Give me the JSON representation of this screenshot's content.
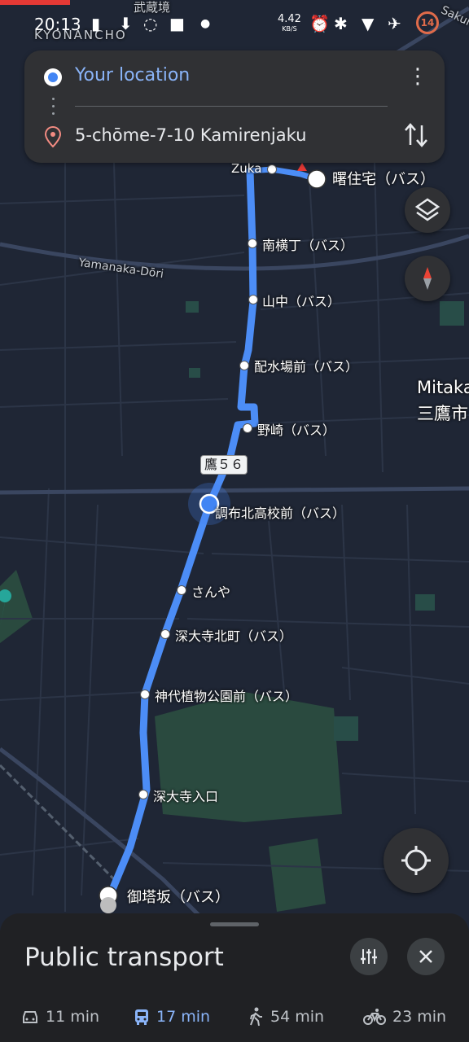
{
  "status_bar": {
    "time": "20:13",
    "speed_value": "4.42",
    "speed_unit": "KB/S",
    "battery": "14"
  },
  "search": {
    "origin": "Your location",
    "destination": "5-chōme-7-10 Kamirenjaku"
  },
  "map": {
    "area_labels": [
      "KYONANCHO",
      "武蔵境",
      "Sakura",
      "Yamanaka-Dōri",
      "Mitaka",
      "三鷹市"
    ],
    "route_badge": "鷹５６",
    "stops": [
      {
        "name": "Zuka"
      },
      {
        "name": "曙住宅（バス）"
      },
      {
        "name": "南横丁（バス）"
      },
      {
        "name": "山中（バス）"
      },
      {
        "name": "配水場前（バス）"
      },
      {
        "name": "野崎（バス）"
      },
      {
        "name": "調布北高校前（バス）"
      },
      {
        "name": "さんや"
      },
      {
        "name": "深大寺北町（バス）"
      },
      {
        "name": "神代植物公園前（バス）"
      },
      {
        "name": "深大寺入口"
      },
      {
        "name": "御塔坂（バス）"
      }
    ]
  },
  "sheet": {
    "title": "Public transport",
    "modes": [
      {
        "icon": "car-icon",
        "label": "11 min"
      },
      {
        "icon": "bus-icon",
        "label": "17 min"
      },
      {
        "icon": "walk-icon",
        "label": "54 min"
      },
      {
        "icon": "bike-icon",
        "label": "23 min"
      }
    ]
  },
  "colors": {
    "route": "#4c8df6",
    "accent": "#8ab4f8",
    "map_bg": "#1f2635",
    "park": "#2a4a3f"
  }
}
